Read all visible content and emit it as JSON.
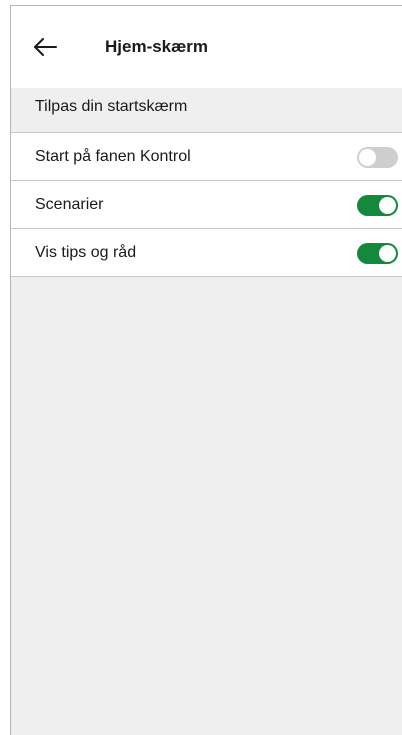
{
  "header": {
    "back_icon": "arrow-left-icon",
    "title": "Hjem-skærm"
  },
  "section": {
    "label": "Tilpas din startskærm"
  },
  "settings": [
    {
      "label": "Start på fanen Kontrol",
      "enabled": false
    },
    {
      "label": "Scenarier",
      "enabled": true
    },
    {
      "label": "Vis tips og råd",
      "enabled": true
    }
  ],
  "colors": {
    "toggle_on": "#15883e",
    "toggle_off": "#cfcfcf",
    "background": "#efefef"
  }
}
